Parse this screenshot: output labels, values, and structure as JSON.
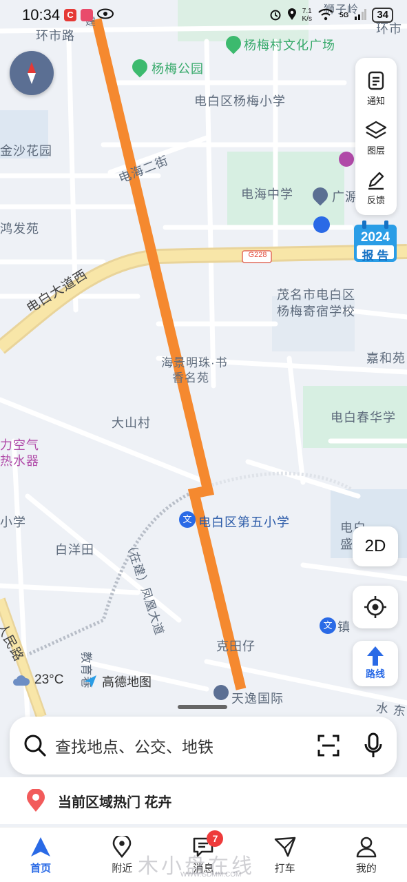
{
  "status_bar": {
    "time": "10:34",
    "speed_value": "7.1",
    "speed_unit": "K/s",
    "network": "5G",
    "battery": "34"
  },
  "map": {
    "labels": {
      "huanshi_road": "环市路",
      "huanshi_right": "环市",
      "shiziling": "狮子岭",
      "jian": "建",
      "yangmeicun_square": "杨梅村文化广场",
      "yangmei_park": "杨梅公园",
      "yangmei_school": "电白区杨梅小学",
      "jinsha_garden": "金沙花园",
      "dianhai_2nd_street": "电海二街",
      "dianhai_middle_school": "电海中学",
      "guangyuan": "广源",
      "hongfa_yuan": "鸿发苑",
      "g228": "G228",
      "dianbai_avenue_west": "电白大道西",
      "boarding_school_line1": "茂名市电白区",
      "boarding_school_line2": "杨梅寄宿学校",
      "haijing_line1": "海景明珠·书",
      "haijing_line2": "香名苑",
      "jiahe_yuan": "嘉和苑",
      "dashan_village": "大山村",
      "dianbai_chunhua": "电白春华学",
      "air_line1": "力空气",
      "air_line2": "热水器",
      "primary_school_left": "小学",
      "fifth_primary": "电白区第五小学",
      "dianbai_right_line1": "电白",
      "dianbai_right_line2": "盛",
      "baiyangtian": "白洋田",
      "fenghuang_avenue": "（在建）凤凰大道",
      "zhen": "镇",
      "ketianzai": "克田仔",
      "renmin_road": "人民路",
      "jiaoyu_xiang": "教育巷",
      "tianyi_international": "天逸国际",
      "shui_dong": "水 东"
    },
    "route_color": "#f5892f"
  },
  "controls": {
    "notify_label": "通知",
    "layers_label": "图层",
    "feedback_label": "反馈",
    "report_year": "2024",
    "report_label": "报 告",
    "mode_2d": "2D",
    "route_label": "路线"
  },
  "weather": {
    "temperature": "23°C",
    "icon": "cloud-icon"
  },
  "brand": {
    "name": "高德地图"
  },
  "search": {
    "placeholder": "查找地点、公交、地铁"
  },
  "hot_area": {
    "text": "当前区域热门 花卉"
  },
  "bottom_nav": {
    "items": [
      {
        "label": "首页",
        "icon": "home-arrow-icon"
      },
      {
        "label": "附近",
        "icon": "location-pin-icon"
      },
      {
        "label": "消息",
        "icon": "message-icon",
        "badge": "7"
      },
      {
        "label": "打车",
        "icon": "taxi-icon"
      },
      {
        "label": "我的",
        "icon": "person-icon"
      }
    ]
  },
  "watermark": {
    "text": "木小盘在线",
    "url": "WWW.GDMM.COM"
  },
  "colors": {
    "accent": "#2a6ae6",
    "route": "#f5892f",
    "badge": "#ee3b3b",
    "road_major": "#f6dc8c",
    "green_area": "#d7efe2"
  }
}
